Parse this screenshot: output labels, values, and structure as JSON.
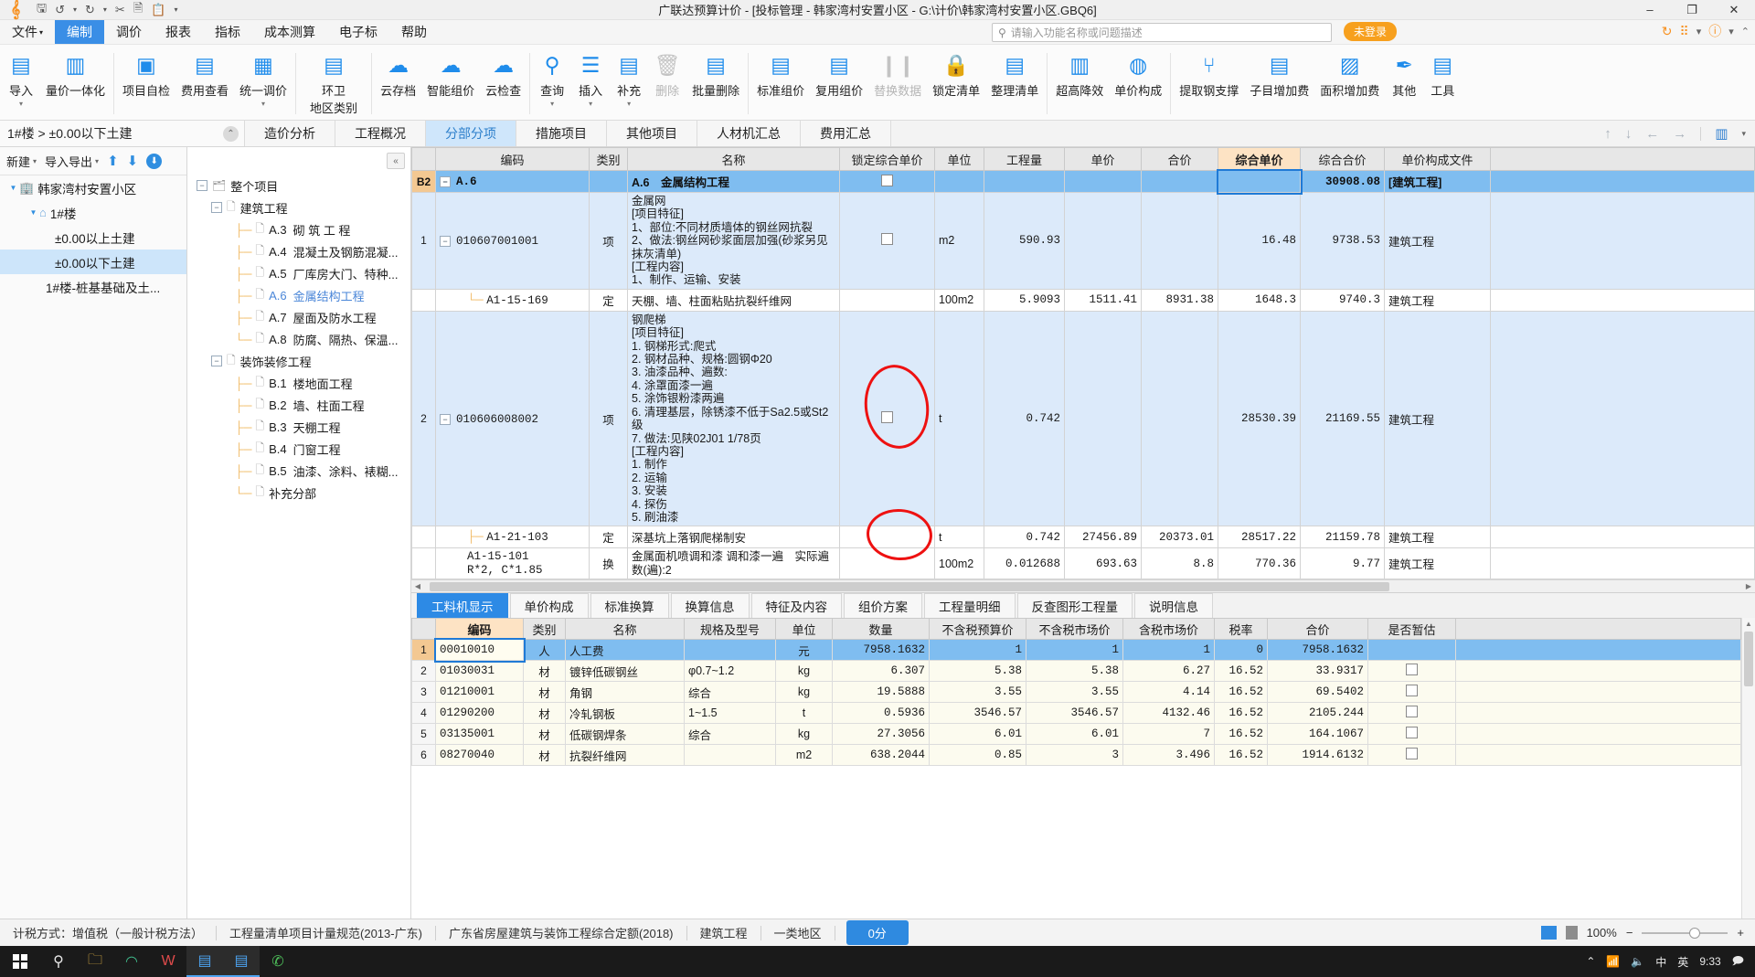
{
  "window": {
    "title": "广联达预算计价 - [投标管理 - 韩家湾村安置小区 - G:\\计价\\韩家湾村安置小区.GBQ6]",
    "minimize": "–",
    "maximize": "❐",
    "close": "✕",
    "quick_access": [
      "save-icon",
      "undo-icon",
      "redo-icon",
      "cut-icon",
      "copy-icon",
      "paste-icon",
      "more-icon"
    ]
  },
  "menubar": {
    "items": [
      "文件",
      "编制",
      "调价",
      "报表",
      "指标",
      "成本测算",
      "电子标",
      "帮助"
    ],
    "active": "编制"
  },
  "search": {
    "placeholder": "请输入功能名称或问题描述",
    "icon": "search-icon"
  },
  "account": {
    "label": "未登录"
  },
  "ribbon": {
    "buttons": [
      {
        "label": "导入",
        "icon": "import-icon",
        "caret": true,
        "disabled": false
      },
      {
        "label": "量价一体化",
        "icon": "price-integration-icon",
        "caret": false,
        "disabled": false
      },
      {
        "label": "项目自检",
        "icon": "self-check-icon",
        "caret": false,
        "disabled": false
      },
      {
        "label": "费用查看",
        "icon": "cost-view-icon",
        "caret": false,
        "disabled": false
      },
      {
        "label": "统一调价",
        "icon": "unified-price-icon",
        "caret": true,
        "disabled": false
      },
      {
        "label": "环卫",
        "label2": "地区类别",
        "icon": "sanitation-icon",
        "caret": true,
        "disabled": false
      },
      {
        "label": "云存档",
        "icon": "cloud-archive-icon",
        "caret": false,
        "disabled": false
      },
      {
        "label": "智能组价",
        "icon": "smart-pricing-icon",
        "caret": false,
        "disabled": false
      },
      {
        "label": "云检查",
        "icon": "cloud-check-icon",
        "caret": false,
        "disabled": false
      },
      {
        "label": "查询",
        "icon": "query-icon",
        "caret": true,
        "disabled": false
      },
      {
        "label": "插入",
        "icon": "insert-icon",
        "caret": true,
        "disabled": false
      },
      {
        "label": "补充",
        "icon": "supplement-icon",
        "caret": true,
        "disabled": false
      },
      {
        "label": "删除",
        "icon": "delete-icon",
        "caret": false,
        "disabled": true
      },
      {
        "label": "批量删除",
        "icon": "batch-delete-icon",
        "caret": false,
        "disabled": false
      },
      {
        "label": "标准组价",
        "icon": "standard-pricing-icon",
        "caret": false,
        "disabled": false
      },
      {
        "label": "复用组价",
        "icon": "reuse-pricing-icon",
        "caret": false,
        "disabled": false
      },
      {
        "label": "替换数据",
        "icon": "replace-data-icon",
        "caret": false,
        "disabled": true
      },
      {
        "label": "锁定清单",
        "icon": "lock-list-icon",
        "caret": false,
        "disabled": false
      },
      {
        "label": "整理清单",
        "icon": "organize-list-icon",
        "caret": false,
        "disabled": false
      },
      {
        "label": "超高降效",
        "icon": "height-efficiency-icon",
        "caret": false,
        "disabled": false
      },
      {
        "label": "单价构成",
        "icon": "unit-price-composition-icon",
        "caret": false,
        "disabled": false
      },
      {
        "label": "提取钢支撑",
        "icon": "extract-steel-support-icon",
        "caret": false,
        "disabled": false
      },
      {
        "label": "子目增加费",
        "icon": "subitem-surcharge-icon",
        "caret": false,
        "disabled": false
      },
      {
        "label": "面积增加费",
        "icon": "area-surcharge-icon",
        "caret": false,
        "disabled": false
      },
      {
        "label": "其他",
        "icon": "other-icon",
        "caret": false,
        "disabled": false
      },
      {
        "label": "工具",
        "icon": "tools-icon",
        "caret": false,
        "disabled": false
      }
    ]
  },
  "breadcrumb": {
    "text": "1#楼 > ±0.00以下土建",
    "collapse_icon": "chevron-up-icon"
  },
  "nav_tabs": {
    "items": [
      "造价分析",
      "工程概况",
      "分部分项",
      "措施项目",
      "其他项目",
      "人材机汇总",
      "费用汇总"
    ],
    "active": "分部分项"
  },
  "nav_right_icons": [
    "arrow-up-icon",
    "arrow-down-icon",
    "arrow-left-icon",
    "arrow-right-icon",
    "settings-icon",
    "chevron-down-icon"
  ],
  "left_pane": {
    "toolbar": {
      "new": "新建",
      "import_export": "导入导出",
      "up_icon": "arrow-up-icon",
      "down_icon": "arrow-down-icon",
      "download_icon": "download-icon"
    },
    "tree": [
      {
        "label": "韩家湾村安置小区",
        "depth": 0,
        "icon": "building-icon",
        "expander": "▼",
        "selected": false
      },
      {
        "label": "1#楼",
        "depth": 1,
        "icon": "home-icon",
        "expander": "▼",
        "selected": false
      },
      {
        "label": "±0.00以上土建",
        "depth": 2,
        "icon": "",
        "expander": "",
        "selected": false
      },
      {
        "label": "±0.00以下土建",
        "depth": 2,
        "icon": "",
        "expander": "",
        "selected": true
      },
      {
        "label": "1#楼-桩基基础及土...",
        "depth": 2,
        "icon": "",
        "expander": "",
        "selected": false
      }
    ]
  },
  "mid_pane": {
    "collapse_icon": "chevron-left-double-icon",
    "tree": [
      {
        "label": "整个项目",
        "code": "",
        "depth": 0,
        "expander": "−",
        "icon": "project-icon",
        "highlight": false
      },
      {
        "label": "建筑工程",
        "code": "",
        "depth": 1,
        "expander": "−",
        "icon": "doc-icon",
        "highlight": false
      },
      {
        "label": "砌 筑 工 程",
        "code": "A.3",
        "depth": 2,
        "expander": "",
        "icon": "doc-icon",
        "highlight": false
      },
      {
        "label": "混凝土及钢筋混凝...",
        "code": "A.4",
        "depth": 2,
        "expander": "",
        "icon": "doc-icon",
        "highlight": false
      },
      {
        "label": "厂库房大门、特种...",
        "code": "A.5",
        "depth": 2,
        "expander": "",
        "icon": "doc-icon",
        "highlight": false
      },
      {
        "label": "金属结构工程",
        "code": "A.6",
        "depth": 2,
        "expander": "",
        "icon": "doc-icon",
        "highlight": true
      },
      {
        "label": "屋面及防水工程",
        "code": "A.7",
        "depth": 2,
        "expander": "",
        "icon": "doc-icon",
        "highlight": false
      },
      {
        "label": "防腐、隔热、保温...",
        "code": "A.8",
        "depth": 2,
        "expander": "",
        "icon": "doc-icon",
        "highlight": false
      },
      {
        "label": "装饰装修工程",
        "code": "",
        "depth": 1,
        "expander": "−",
        "icon": "doc-icon",
        "highlight": false
      },
      {
        "label": "楼地面工程",
        "code": "B.1",
        "depth": 2,
        "expander": "",
        "icon": "doc-icon",
        "highlight": false
      },
      {
        "label": "墙、柱面工程",
        "code": "B.2",
        "depth": 2,
        "expander": "",
        "icon": "doc-icon",
        "highlight": false
      },
      {
        "label": "天棚工程",
        "code": "B.3",
        "depth": 2,
        "expander": "",
        "icon": "doc-icon",
        "highlight": false
      },
      {
        "label": "门窗工程",
        "code": "B.4",
        "depth": 2,
        "expander": "",
        "icon": "doc-icon",
        "highlight": false
      },
      {
        "label": "油漆、涂料、裱糊...",
        "code": "B.5",
        "depth": 2,
        "expander": "",
        "icon": "doc-icon",
        "highlight": false
      },
      {
        "label": "补充分部",
        "code": "",
        "depth": 2,
        "expander": "",
        "icon": "doc-icon",
        "highlight": false
      }
    ]
  },
  "main_grid": {
    "columns": [
      "",
      "编码",
      "类别",
      "名称",
      "锁定综合单价",
      "单位",
      "工程量",
      "单价",
      "合价",
      "综合单价",
      "综合合价",
      "单价构成文件",
      ""
    ],
    "accent_column": "综合单价",
    "rows": [
      {
        "kind": "group",
        "rowno": "B2",
        "expander": "−",
        "code": "A.6",
        "category": "",
        "name": "A.6　金属结构工程",
        "lock": "checkbox",
        "unit": "",
        "qty": "",
        "price": "",
        "total": "",
        "comp_price": "",
        "comp_total": "30908.08",
        "file": "[建筑工程]"
      },
      {
        "kind": "item",
        "rowno": "1",
        "expander": "−",
        "code": "010607001001",
        "category": "项",
        "name": "金属网\n[项目特征]\n1、部位:不同材质墙体的钢丝网抗裂\n2、做法:钢丝网砂浆面层加强(砂浆另见抹灰清单)\n[工程内容]\n1、制作、运输、安装",
        "lock": "checkbox",
        "unit": "m2",
        "qty": "590.93",
        "price": "",
        "total": "",
        "comp_price": "16.48",
        "comp_total": "9738.53",
        "file": "建筑工程"
      },
      {
        "kind": "def",
        "rowno": "",
        "expander": "",
        "code": "A1-15-169",
        "category": "定",
        "name": "天棚、墙、柱面粘贴抗裂纤维网",
        "lock": "",
        "unit": "100m2",
        "qty": "5.9093",
        "price": "1511.41",
        "total": "8931.38",
        "comp_price": "1648.3",
        "comp_total": "9740.3",
        "file": "建筑工程"
      },
      {
        "kind": "item",
        "rowno": "2",
        "expander": "−",
        "code": "010606008002",
        "category": "项",
        "name": "钢爬梯\n[项目特征]\n1. 钢梯形式:爬式\n2. 钢材品种、规格:圆钢Φ20\n3. 油漆品种、遍数:\n4. 涂罩面漆一遍\n5. 涂饰银粉漆两遍\n6. 清理基层，除锈漆不低于Sa2.5或St2级\n7. 做法:见陕02J01 1/78页\n[工程内容]\n1. 制作\n2. 运输\n3. 安装\n4. 探伤\n5. 刷油漆",
        "lock": "checkbox",
        "unit": "t",
        "qty": "0.742",
        "price": "",
        "total": "",
        "comp_price": "28530.39",
        "comp_total": "21169.55",
        "file": "建筑工程"
      },
      {
        "kind": "def",
        "rowno": "",
        "expander": "",
        "code": "A1-21-103",
        "category": "定",
        "name": "深基坑上落钢爬梯制安",
        "lock": "",
        "unit": "t",
        "qty": "0.742",
        "price": "27456.89",
        "total": "20373.01",
        "comp_price": "28517.22",
        "comp_total": "21159.78",
        "file": "建筑工程"
      },
      {
        "kind": "def",
        "rowno": "",
        "expander": "",
        "code": "A1-15-101\nR*2, C*1.85",
        "category": "换",
        "name": "金属面机喷调和漆 调和漆一遍　实际遍数(遍):2",
        "lock": "",
        "unit": "100m2",
        "qty": "0.012688",
        "price": "693.63",
        "total": "8.8",
        "comp_price": "770.36",
        "comp_total": "9.77",
        "file": "建筑工程"
      }
    ]
  },
  "bottom_panel": {
    "tabs": [
      "工料机显示",
      "单价构成",
      "标准换算",
      "换算信息",
      "特征及内容",
      "组价方案",
      "工程量明细",
      "反查图形工程量",
      "说明信息"
    ],
    "active": "工料机显示",
    "columns": [
      "",
      "编码",
      "类别",
      "名称",
      "规格及型号",
      "单位",
      "数量",
      "不含税预算价",
      "不含税市场价",
      "含税市场价",
      "税率",
      "合价",
      "是否暂估"
    ],
    "accent_column": "编码",
    "rows": [
      {
        "rowno": "1",
        "code": "00010010",
        "cat": "人",
        "name": "人工费",
        "spec": "",
        "unit": "元",
        "qty": "7958.1632",
        "p1": "1",
        "p2": "1",
        "p3": "1",
        "tax": "0",
        "total": "7958.1632",
        "est": false,
        "selected": true
      },
      {
        "rowno": "2",
        "code": "01030031",
        "cat": "材",
        "name": "镀锌低碳钢丝",
        "spec": "φ0.7~1.2",
        "unit": "kg",
        "qty": "6.307",
        "p1": "5.38",
        "p2": "5.38",
        "p3": "6.27",
        "tax": "16.52",
        "total": "33.9317",
        "est": true,
        "selected": false
      },
      {
        "rowno": "3",
        "code": "01210001",
        "cat": "材",
        "name": "角钢",
        "spec": "综合",
        "unit": "kg",
        "qty": "19.5888",
        "p1": "3.55",
        "p2": "3.55",
        "p3": "4.14",
        "tax": "16.52",
        "total": "69.5402",
        "est": true,
        "selected": false
      },
      {
        "rowno": "4",
        "code": "01290200",
        "cat": "材",
        "name": "冷轧钢板",
        "spec": "1~1.5",
        "unit": "t",
        "qty": "0.5936",
        "p1": "3546.57",
        "p2": "3546.57",
        "p3": "4132.46",
        "tax": "16.52",
        "total": "2105.244",
        "est": true,
        "selected": false
      },
      {
        "rowno": "5",
        "code": "03135001",
        "cat": "材",
        "name": "低碳钢焊条",
        "spec": "综合",
        "unit": "kg",
        "qty": "27.3056",
        "p1": "6.01",
        "p2": "6.01",
        "p3": "7",
        "tax": "16.52",
        "total": "164.1067",
        "est": true,
        "selected": false
      },
      {
        "rowno": "6",
        "code": "08270040",
        "cat": "材",
        "name": "抗裂纤维网",
        "spec": "",
        "unit": "m2",
        "qty": "638.2044",
        "p1": "0.85",
        "p2": "3",
        "p3": "3.496",
        "tax": "16.52",
        "total": "1914.6132",
        "est": true,
        "selected": false
      }
    ]
  },
  "statusbar": {
    "items": [
      "计税方式：增值税（一般计税方法）",
      "工程量清单项目计量规范(2013-广东)",
      "广东省房屋建筑与装饰工程综合定额(2018)",
      "建筑工程",
      "一类地区"
    ],
    "score": "0分",
    "zoom": "100%",
    "zoom_out": "−",
    "zoom_in": "+"
  },
  "taskbar": {
    "start_icon": "windows-icon",
    "items": [
      "search-icon",
      "explorer-icon",
      "edge-icon",
      "word-icon",
      "app-icon-1",
      "app-icon-2",
      "wechat-icon"
    ],
    "tray": [
      "chevron-up-icon",
      "network-icon",
      "volume-icon",
      "ime-cn",
      "ime-en"
    ],
    "clock": "9:33",
    "notification_icon": "notification-icon"
  }
}
